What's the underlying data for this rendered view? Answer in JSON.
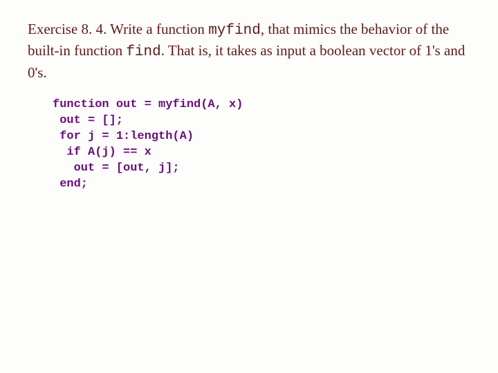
{
  "exercise": {
    "label": "Exercise 8. 4.",
    "pre_text": " Write a function ",
    "func1": "myfind",
    "mid_text": ", that mimics the behavior of the built-in function ",
    "func2": "find",
    "post_text": ". That is, it takes as input a boolean vector of 1's and 0's."
  },
  "code": {
    "l1": "function out = myfind(A, x)",
    "l2": " out = [];",
    "l3": " for j = 1:length(A)",
    "l4": "  if A(j) == x",
    "l5": "   out = [out, j];",
    "l6": " end;"
  }
}
